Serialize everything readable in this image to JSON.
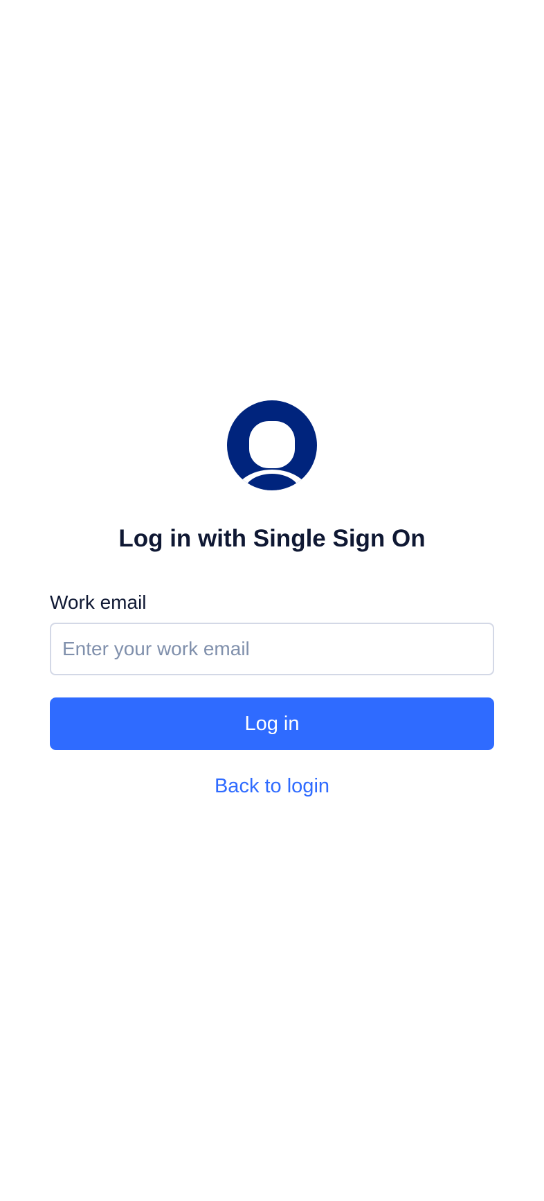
{
  "icons": {
    "avatar": "user-avatar-icon"
  },
  "colors": {
    "brand_dark": "#00247d",
    "primary": "#2f6bff",
    "heading_text": "#0f1833",
    "placeholder_text": "#8090ac",
    "input_border": "#d3d8e6",
    "background": "#ffffff"
  },
  "sso": {
    "title": "Log in with Single Sign On",
    "email_label": "Work email",
    "email_value": "",
    "email_placeholder": "Enter your work email",
    "submit_label": "Log in",
    "back_link_label": "Back to login"
  }
}
